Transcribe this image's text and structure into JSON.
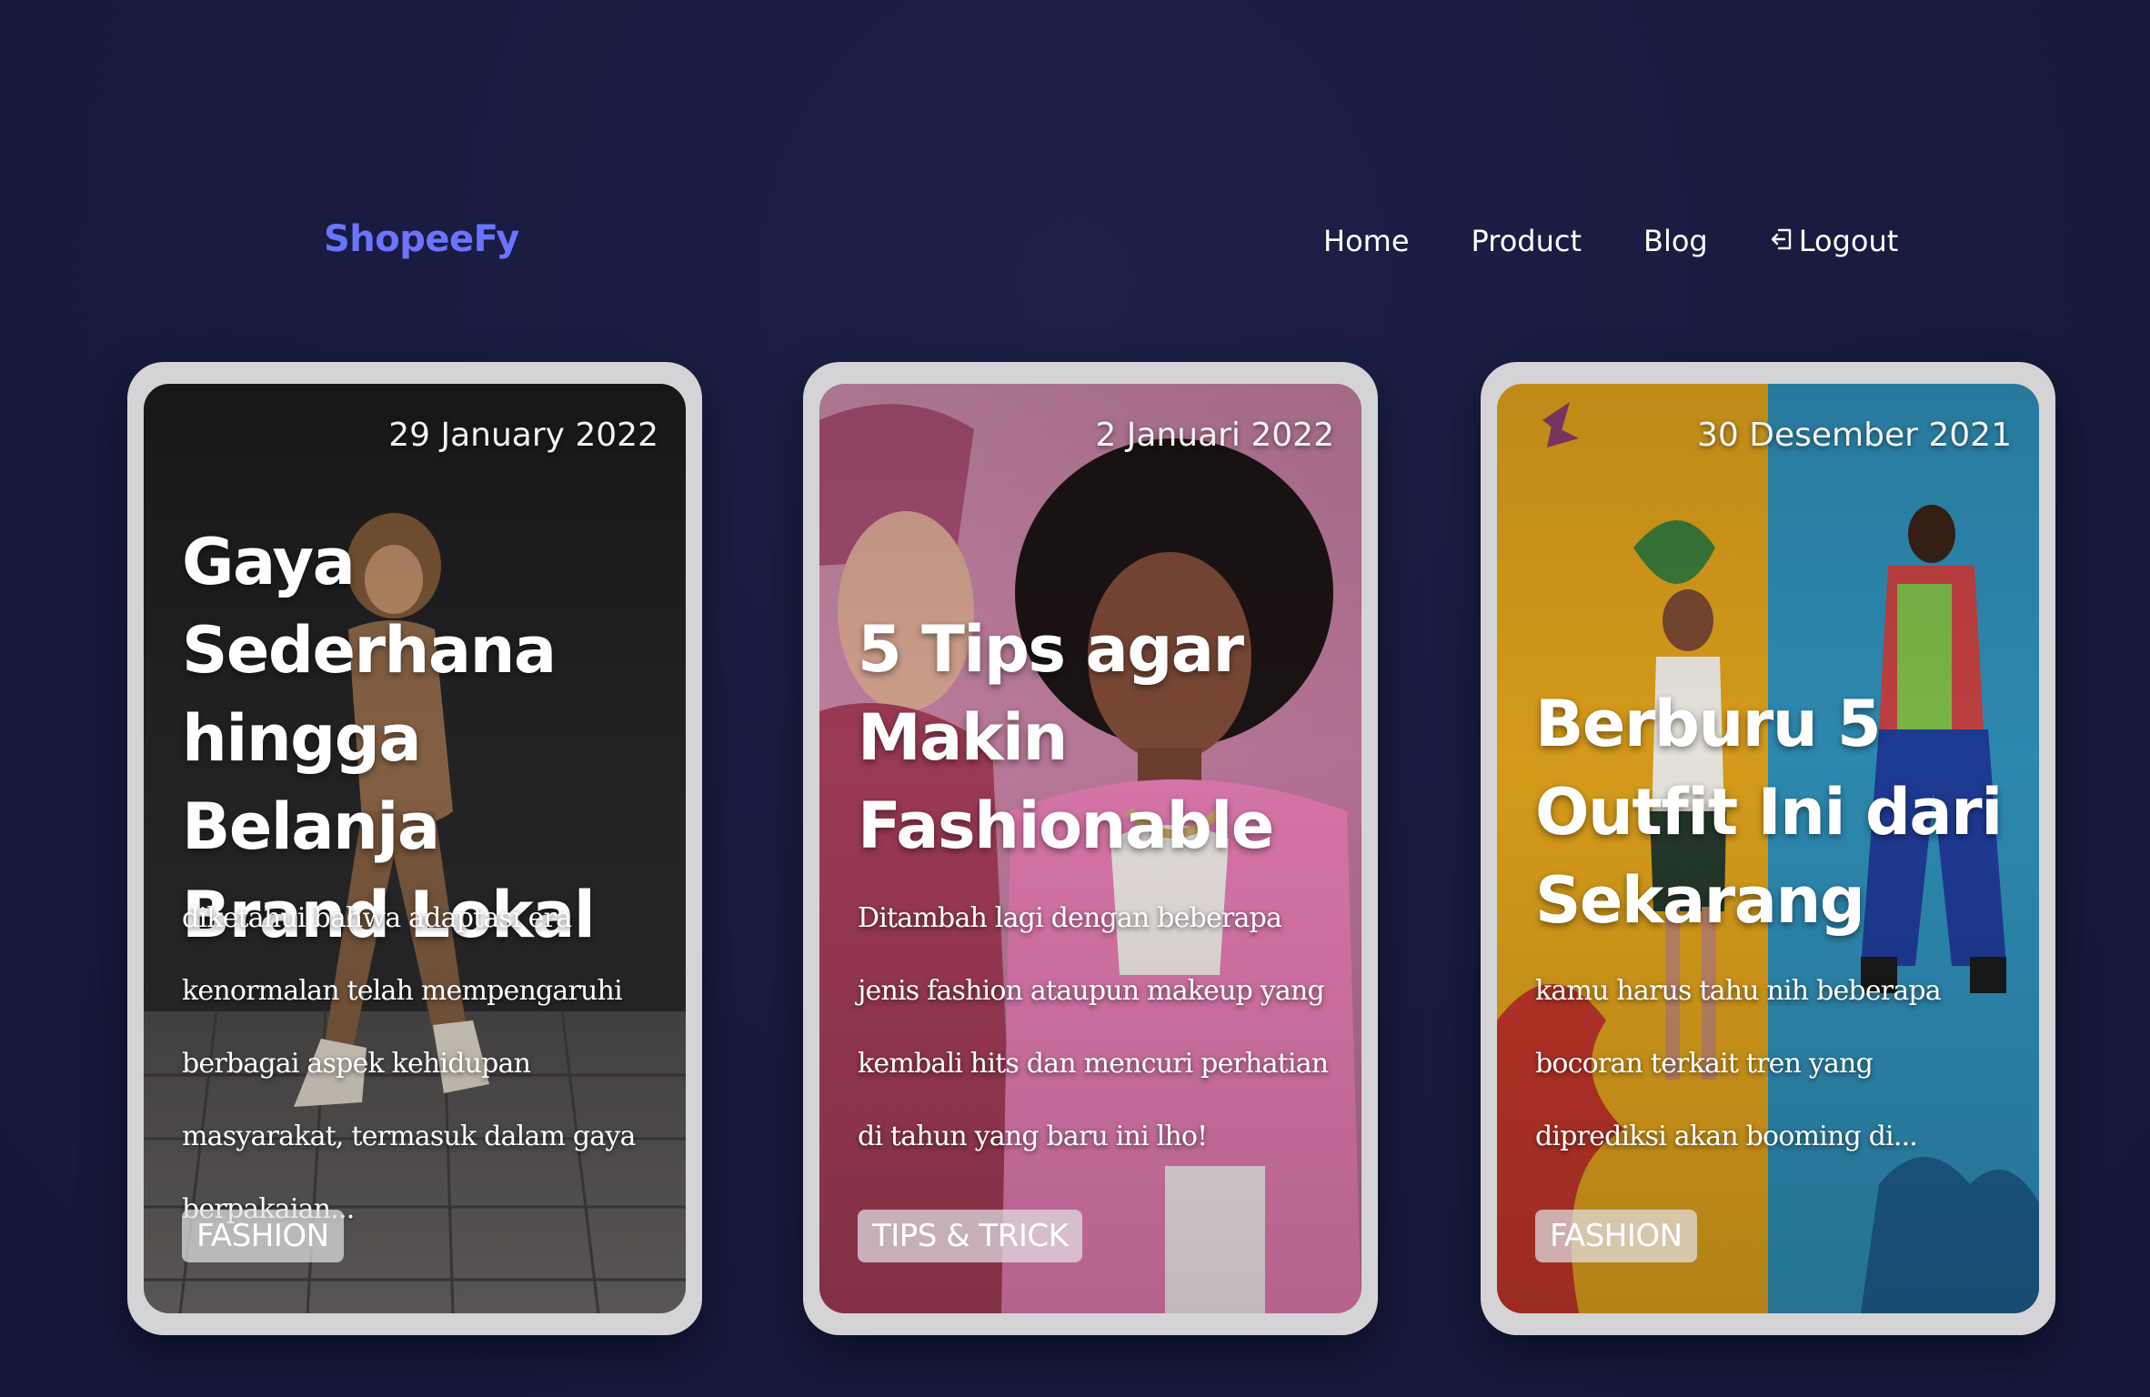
{
  "brand": "ShopeeFy",
  "nav": {
    "home": "Home",
    "product": "Product",
    "blog": "Blog",
    "logout": "Logout",
    "logout_icon": "logout-icon"
  },
  "cards": [
    {
      "date": "29 January 2022",
      "title": "Gaya Sederhana hingga Belanja Brand Lokal",
      "excerpt": "diketahui bahwa adaptasi era kenormalan telah mempengaruhi berbagai aspek kehidupan masyarakat, termasuk dalam gaya berpakaian...",
      "tag": "FASHION"
    },
    {
      "date": "2 Januari 2022",
      "title": "5 Tips agar Makin Fashionable",
      "excerpt": "Ditambah lagi dengan beberapa jenis fashion ataupun makeup yang kembali hits dan mencuri perhatian di tahun yang baru ini lho!",
      "tag": "TIPS & TRICK"
    },
    {
      "date": "30 Desember 2021",
      "title": "Berburu 5 Outfit Ini dari Sekarang",
      "excerpt": "kamu harus tahu nih beberapa bocoran terkait tren yang diprediksi akan booming di...",
      "tag": "FASHION"
    }
  ],
  "colors": {
    "background": "#181a3f",
    "brand": "#6b74ff",
    "card_frame": "#d4d4d6",
    "nav_text": "#ffffff"
  }
}
